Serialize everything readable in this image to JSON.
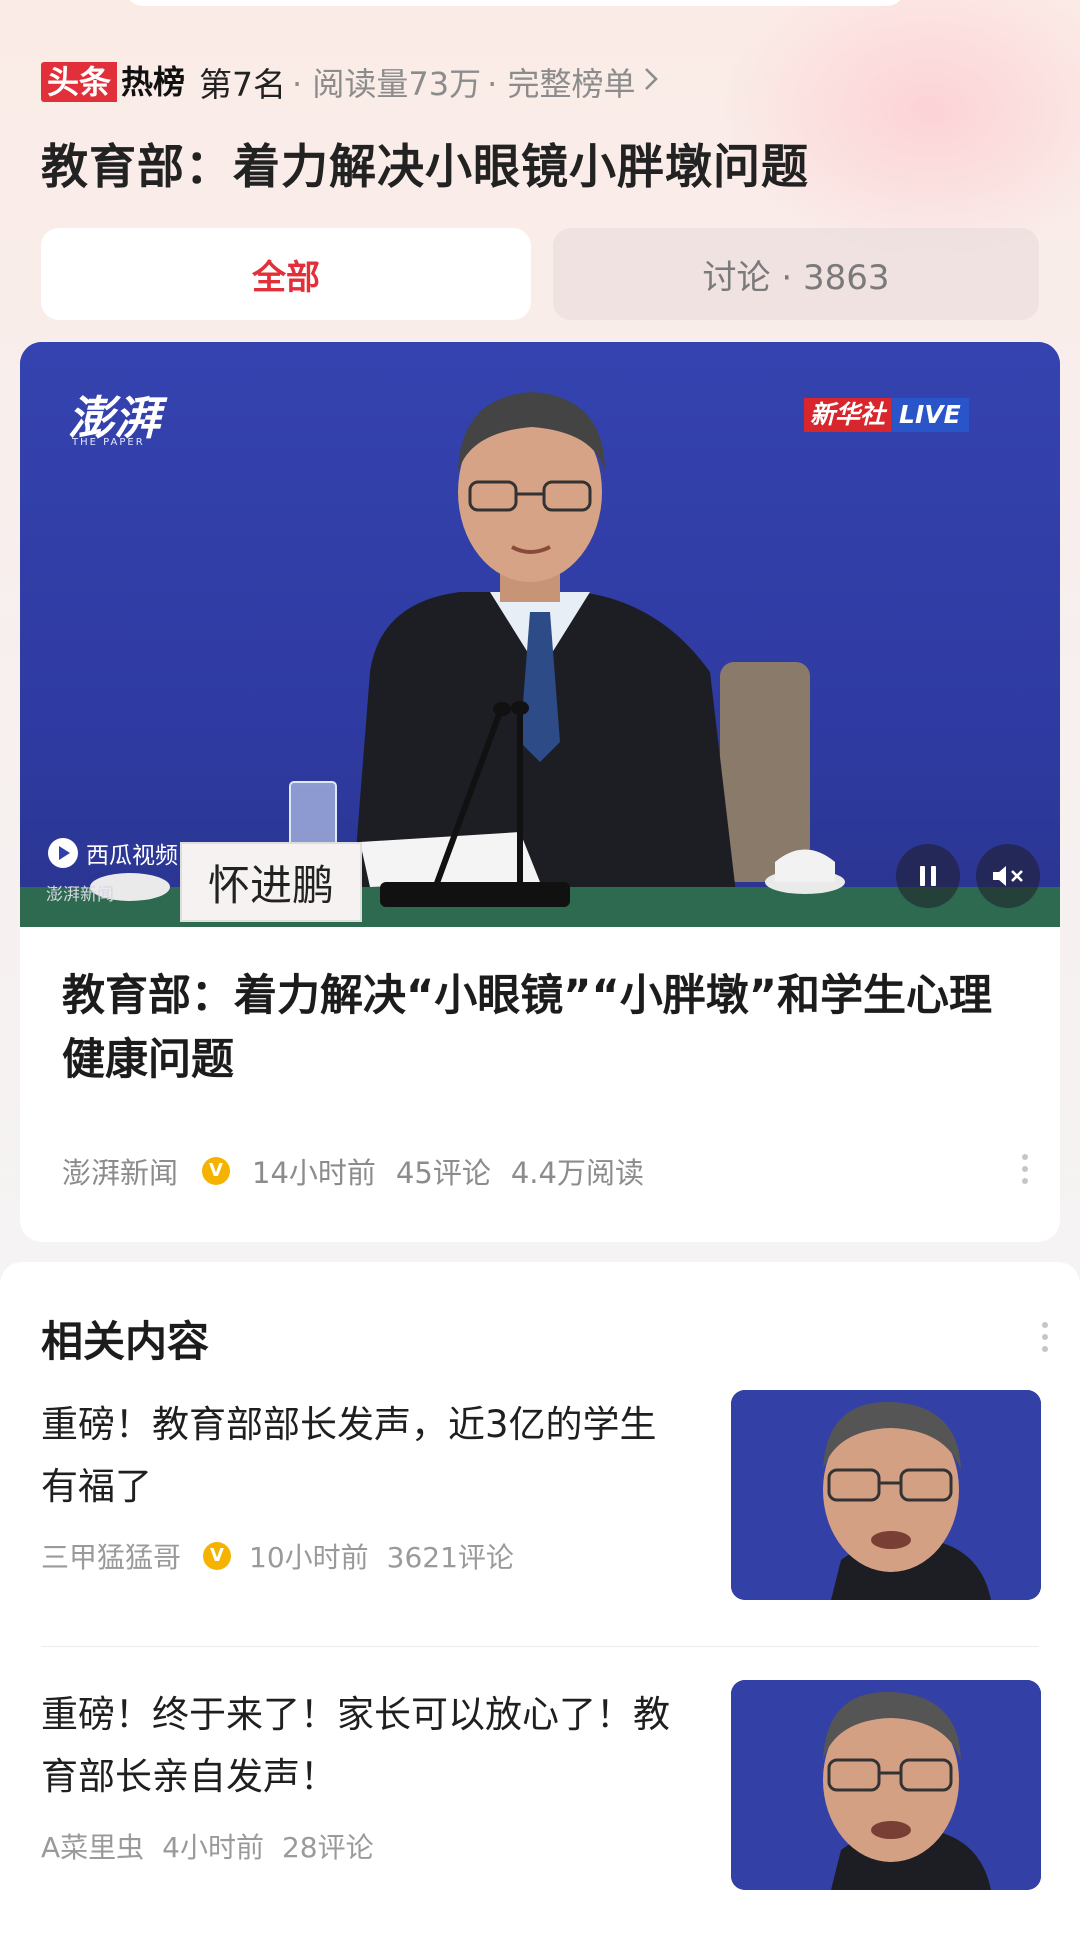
{
  "hot_list": {
    "logo_left": "头条",
    "logo_right": "热榜",
    "rank": "第7名",
    "read_count": "· 阅读量73万",
    "full_list_link": "· 完整榜单"
  },
  "topic_title": "教育部：着力解决小眼镜小胖墩问题",
  "tabs": [
    {
      "label": "全部",
      "active": true
    },
    {
      "label": "讨论 · 3863",
      "active": false
    }
  ],
  "featured": {
    "video": {
      "watermark_paper": "澎湃",
      "watermark_paper_sub": "THE PAPER",
      "live_badge_left": "新华社",
      "live_badge_right": "LIVE",
      "platform_watermark": "西瓜视频",
      "platform_source": "澎湃新闻",
      "nameplate": "怀进鹏"
    },
    "title": "教育部：着力解决“小眼镜”“小胖墩”和学生心理健康问题",
    "source": "澎湃新闻",
    "verified_mark": "V",
    "time": "14小时前",
    "comments": "45评论",
    "reads": "4.4万阅读"
  },
  "related": {
    "heading": "相关内容",
    "items": [
      {
        "title": "重磅！教育部部长发声，近3亿的学生有福了",
        "author": "三甲猛猛哥",
        "verified": true,
        "time": "10小时前",
        "comments": "3621评论"
      },
      {
        "title": "重磅！终于来了！家长可以放心了！教育部长亲自发声！",
        "author": "A菜里虫",
        "verified": false,
        "time": "4小时前",
        "comments": "28评论"
      }
    ]
  },
  "colors": {
    "accent_red": "#e2303a",
    "video_blue": "#2f3ea8",
    "verified_gold": "#f5b300",
    "meta_gray": "#8c8c8c"
  }
}
